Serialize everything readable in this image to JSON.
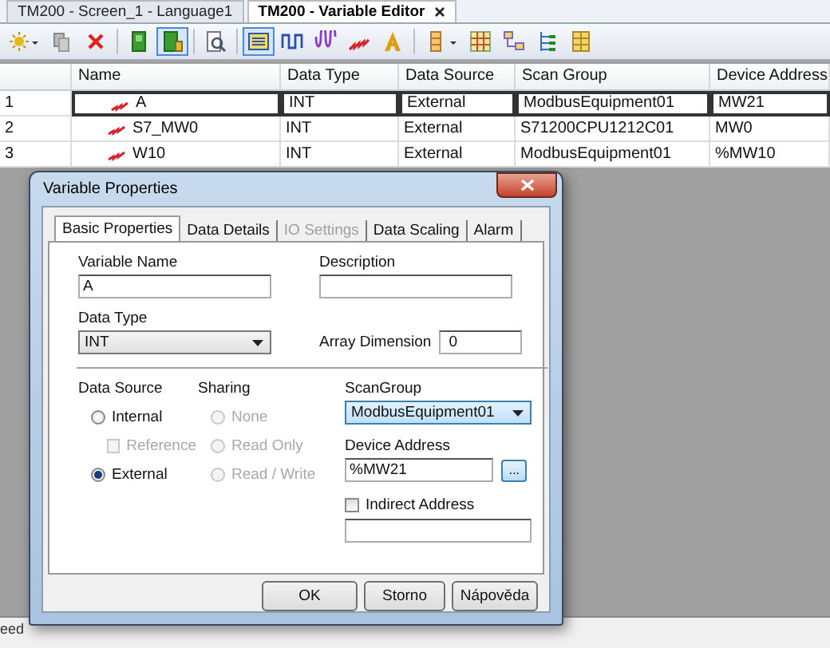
{
  "editor_tabs": [
    {
      "label": "TM200 - Screen_1 - Language1",
      "selected": false
    },
    {
      "label": "TM200 - Variable Editor",
      "selected": true
    }
  ],
  "toolbar": [
    {
      "pressed": false
    },
    {
      "pressed": false
    },
    {
      "pressed": false
    },
    {
      "pressed": false
    },
    {
      "pressed": true
    },
    {
      "pressed": false
    },
    {
      "pressed": true
    },
    {
      "pressed": false
    },
    {
      "pressed": false
    },
    {
      "pressed": false
    },
    {
      "pressed": false
    },
    {
      "pressed": false
    },
    {
      "pressed": false
    },
    {
      "pressed": false
    },
    {
      "pressed": false
    },
    {
      "pressed": false
    }
  ],
  "table": {
    "columns": [
      "Name",
      "Data Type",
      "Data Source",
      "Scan Group",
      "Device Address"
    ],
    "rows": [
      {
        "number": "1",
        "name": "A",
        "data_type": "INT",
        "data_source": "External",
        "scan_group": "ModbusEquipment01",
        "device_address": "MW21",
        "selected": true
      },
      {
        "number": "2",
        "name": "S7_MW0",
        "data_type": "INT",
        "data_source": "External",
        "scan_group": "S71200CPU1212C01",
        "device_address": "MW0",
        "selected": false
      },
      {
        "number": "3",
        "name": "W10",
        "data_type": "INT",
        "data_source": "External",
        "scan_group": "ModbusEquipment01",
        "device_address": "%MW10",
        "selected": false
      }
    ]
  },
  "status_bar": {
    "text": "eed"
  },
  "dialog": {
    "title": "Variable Properties",
    "tabs": [
      {
        "label": "Basic Properties",
        "selected": true,
        "disabled": false
      },
      {
        "label": "Data Details",
        "selected": false,
        "disabled": false
      },
      {
        "label": "IO Settings",
        "selected": false,
        "disabled": true
      },
      {
        "label": "Data Scaling",
        "selected": false,
        "disabled": false
      },
      {
        "label": "Alarm",
        "selected": false,
        "disabled": false
      }
    ],
    "variable_name": {
      "label": "Variable Name",
      "value": "A"
    },
    "description": {
      "label": "Description"
    },
    "data_type": {
      "label": "Data Type",
      "value": "INT"
    },
    "array_dimension": {
      "label": "Array Dimension",
      "value": "0"
    },
    "data_source": {
      "label": "Data Source",
      "options": [
        {
          "kind": "radio",
          "label": "Internal",
          "selected": false,
          "disabled": false
        },
        {
          "kind": "checkbox",
          "label": "Reference",
          "checked": false,
          "disabled": true
        },
        {
          "kind": "radio",
          "label": "External",
          "selected": true,
          "disabled": false
        }
      ]
    },
    "sharing": {
      "label": "Sharing",
      "options": [
        {
          "kind": "radio",
          "label": "None",
          "selected": false,
          "disabled": true
        },
        {
          "kind": "radio",
          "label": "Read Only",
          "selected": false,
          "disabled": true
        },
        {
          "kind": "radio",
          "label": "Read / Write",
          "selected": false,
          "disabled": true
        }
      ]
    },
    "scan_group": {
      "label": "ScanGroup",
      "value": "ModbusEquipment01"
    },
    "device_address": {
      "label": "Device Address",
      "value": "%MW21",
      "browse": "..."
    },
    "indirect_address": {
      "label": "Indirect Address",
      "checked": false
    },
    "buttons": [
      "OK",
      "Storno",
      "Nápověda"
    ]
  }
}
